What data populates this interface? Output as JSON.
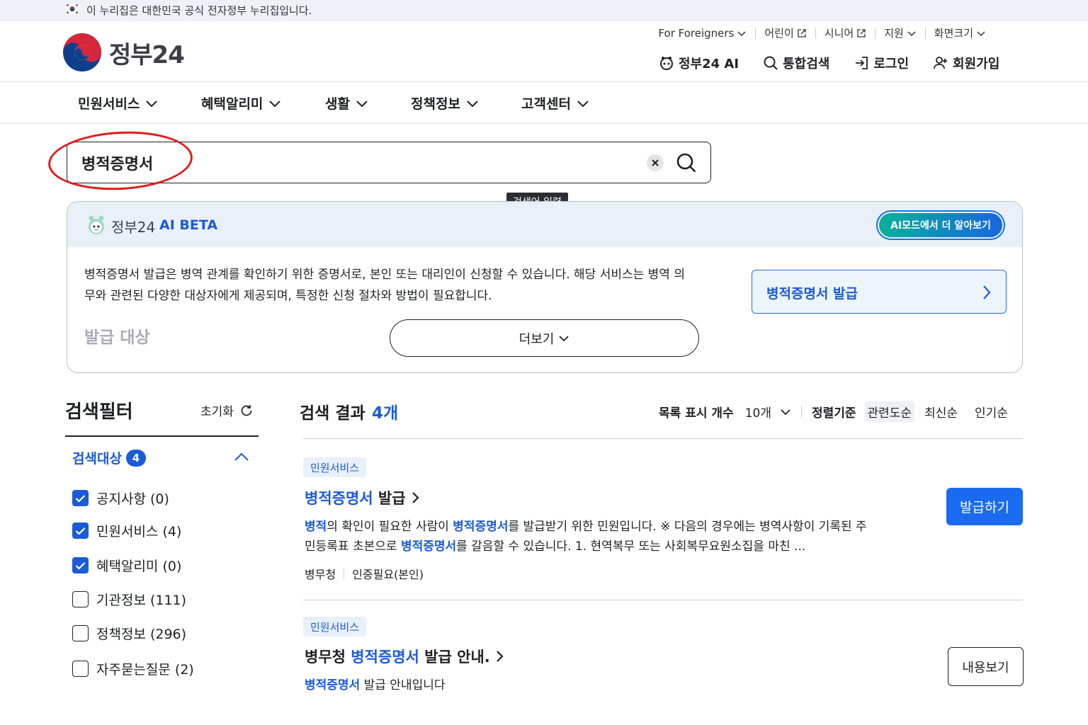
{
  "gov_banner": {
    "text": "이 누리집은 대한민국 공식 전자정부 누리집입니다."
  },
  "logo": {
    "text": "정부24"
  },
  "util_links": [
    {
      "label": "For Foreigners",
      "icon": "chevron-down-icon"
    },
    {
      "label": "어린이",
      "icon": "external-link-icon"
    },
    {
      "label": "시니어",
      "icon": "external-link-icon"
    },
    {
      "label": "지원",
      "icon": "chevron-down-icon"
    },
    {
      "label": "화면크기",
      "icon": "chevron-down-icon"
    }
  ],
  "main_links": {
    "ai": "정부24 AI",
    "search": "통합검색",
    "login": "로그인",
    "signup": "회원가입"
  },
  "nav": [
    "민원서비스",
    "혜택알리미",
    "생활",
    "정책정보",
    "고객센터"
  ],
  "search": {
    "value": "병적증명서",
    "tooltip": "검색어 입력"
  },
  "ai_panel": {
    "brand": "정부24",
    "beta": "AI BETA",
    "mode_button": "AI모드에서 더 알아보기",
    "summary_line1": "병적증명서 발급은 병역 관계를 확인하기 위한 증명서로, 본인 또는 대리인이 신청할 수 있습니다. 해당 서비스는 병역 의",
    "summary_line2": "무와 관련된 다양한 대상자에게 제공되며, 특정한 신청 절차와 방법이 필요합니다.",
    "target_label": "발급 대상",
    "more_button": "더보기",
    "quick_card": "병적증명서 발급"
  },
  "filter": {
    "title": "검색필터",
    "reset": "초기화",
    "group_label": "검색대상",
    "group_count": "4",
    "options": [
      {
        "label": "공지사항 (0)",
        "checked": true
      },
      {
        "label": "민원서비스 (4)",
        "checked": true
      },
      {
        "label": "혜택알리미 (0)",
        "checked": true
      },
      {
        "label": "기관정보 (111)",
        "checked": false
      },
      {
        "label": "정책정보 (296)",
        "checked": false
      },
      {
        "label": "자주묻는질문 (2)",
        "checked": false
      }
    ]
  },
  "results": {
    "title": "검색 결과",
    "count": "4개",
    "list_count_label": "목록 표시 개수",
    "list_count_value": "10개",
    "sort_label": "정렬기준",
    "sort_options": [
      "관련도순",
      "최신순",
      "인기순"
    ],
    "items": [
      {
        "category": "민원서비스",
        "title_hl": "병적증명서",
        "title_rest": " 발급",
        "desc_l1": [
          {
            "t": "병적",
            "h": true
          },
          {
            "t": "의 확인이 필요한 사람이 ",
            "h": false
          },
          {
            "t": "병적증명서",
            "h": true
          },
          {
            "t": "를 발급받기 위한 민원입니다. ※ 다음의 경우에는 병역사항이 기록된 주",
            "h": false
          }
        ],
        "desc_l2": [
          {
            "t": "민등록표 초본으로 ",
            "h": false
          },
          {
            "t": "병적증명서",
            "h": true
          },
          {
            "t": "를 갈음할 수 있습니다. 1. 현역복무 또는 사회복무요원소집을 마친 ...",
            "h": false
          }
        ],
        "agency": "병무청",
        "auth": "인증필요(본인)",
        "button": "발급하기"
      },
      {
        "category": "민원서비스",
        "title_pre": "병무청 ",
        "title_hl": "병적증명서",
        "title_rest": " 발급 안내.",
        "desc_hl": "병적증명서",
        "desc_rest": " 발급 안내입니다",
        "button": "내용보기"
      }
    ]
  },
  "colors": {
    "accent": "#1a5bd8",
    "button_blue": "#1a6bf0",
    "highlight_circle": "#e01b1b",
    "ai_teal": "#0ab19a"
  }
}
